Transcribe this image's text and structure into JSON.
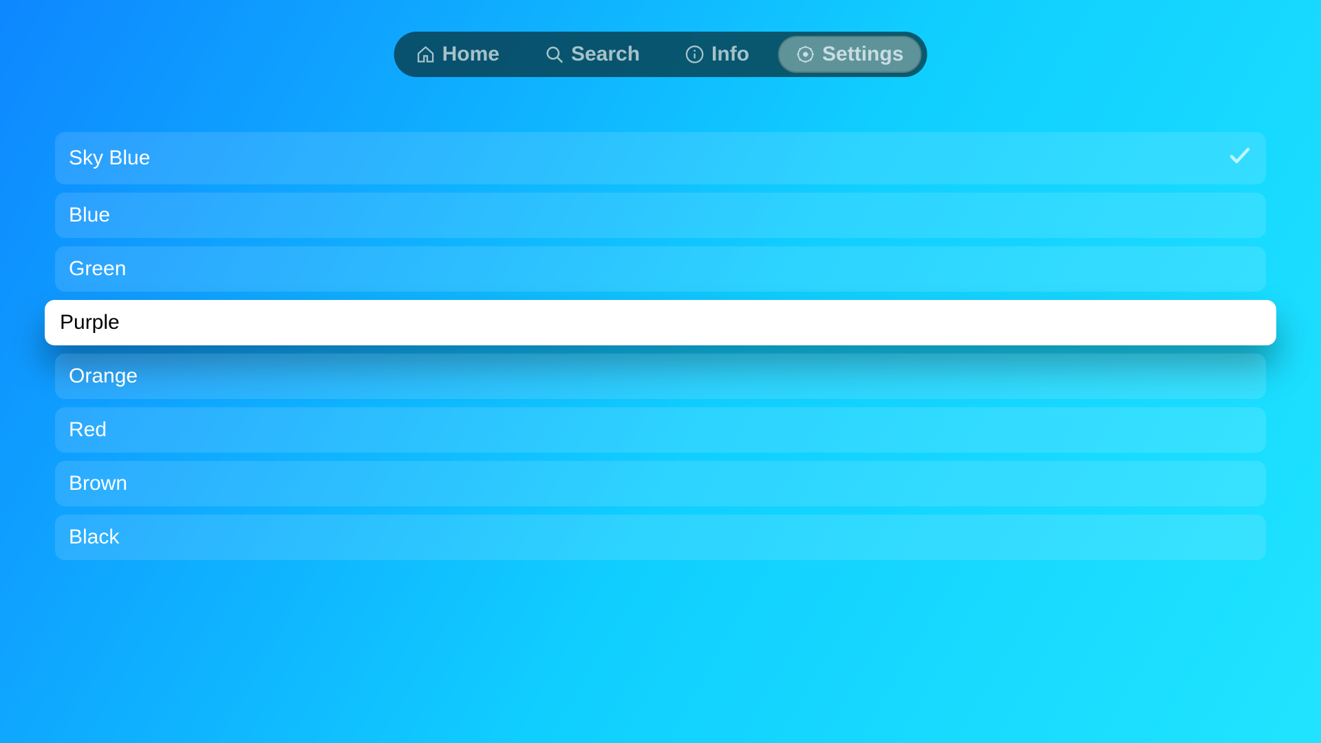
{
  "nav": {
    "items": [
      {
        "id": "home",
        "label": "Home",
        "icon": "home",
        "selected": false
      },
      {
        "id": "search",
        "label": "Search",
        "icon": "search",
        "selected": false
      },
      {
        "id": "info",
        "label": "Info",
        "icon": "info",
        "selected": false
      },
      {
        "id": "settings",
        "label": "Settings",
        "icon": "gear",
        "selected": true
      }
    ]
  },
  "list": {
    "items": [
      {
        "label": "Sky Blue",
        "checked": true,
        "focused": false
      },
      {
        "label": "Blue",
        "checked": false,
        "focused": false
      },
      {
        "label": "Green",
        "checked": false,
        "focused": false
      },
      {
        "label": "Purple",
        "checked": false,
        "focused": true
      },
      {
        "label": "Orange",
        "checked": false,
        "focused": false
      },
      {
        "label": "Red",
        "checked": false,
        "focused": false
      },
      {
        "label": "Brown",
        "checked": false,
        "focused": false
      },
      {
        "label": "Black",
        "checked": false,
        "focused": false
      }
    ]
  }
}
